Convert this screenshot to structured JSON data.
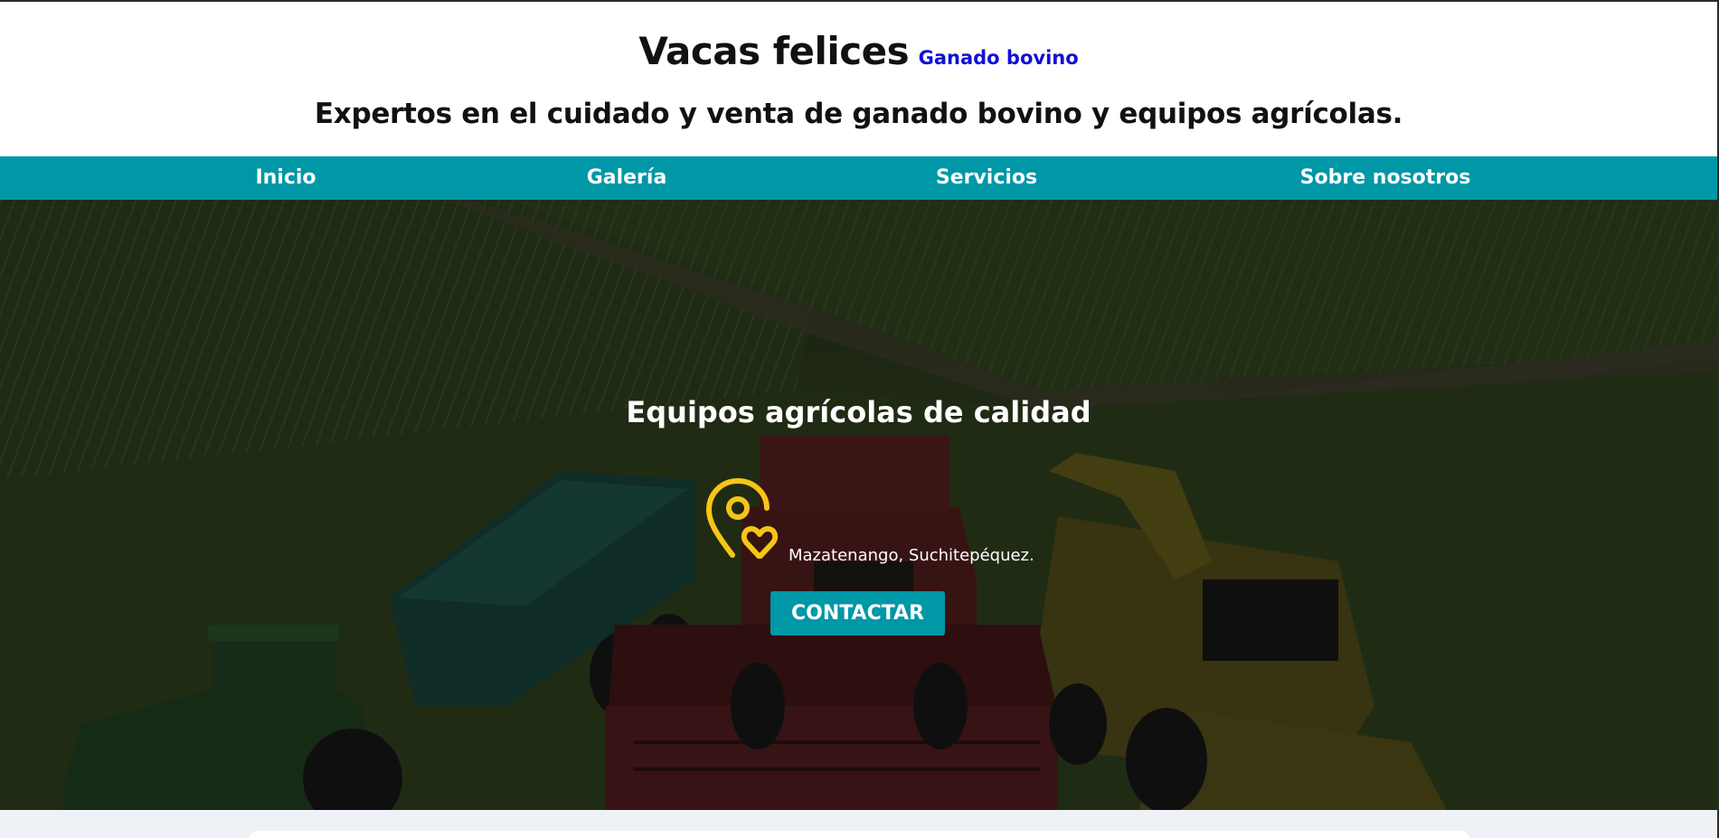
{
  "header": {
    "title": "Vacas felices",
    "subtitle_link": "Ganado bovino",
    "tagline": "Expertos en el cuidado y venta de ganado bovino y equipos agrícolas."
  },
  "nav": {
    "items": [
      {
        "label": "Inicio"
      },
      {
        "label": "Galería"
      },
      {
        "label": "Servicios"
      },
      {
        "label": "Sobre nosotros"
      }
    ]
  },
  "hero": {
    "title": "Equipos agrícolas de calidad",
    "location": "Mazatenango, Suchitepéquez.",
    "cta_label": "CONTACTAR",
    "location_icon": "map-pin-heart-icon"
  },
  "colors": {
    "accent": "#0097a7",
    "link": "#1010d8",
    "icon": "#f5c518"
  }
}
